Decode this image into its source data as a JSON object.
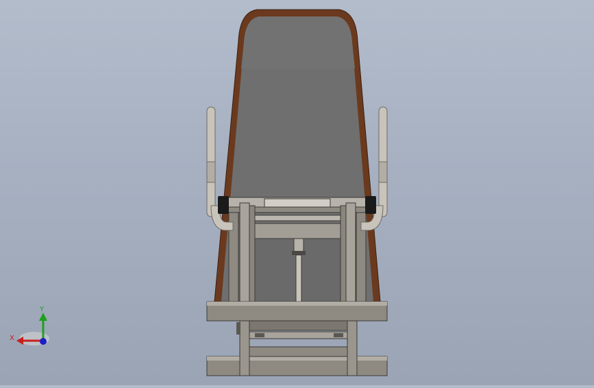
{
  "model": {
    "colors": {
      "background_top": "#b3bccb",
      "background_bottom": "#9aa4b4",
      "seat_panel": "#6d6d6d",
      "seat_frame": "#6b3a1e",
      "metal": "#a8a39b",
      "metal_dark": "#6e6a63",
      "pad_black": "#1a1a1a"
    }
  },
  "triad": {
    "x_label": "X",
    "y_label": "Y",
    "x_color": "#c81e1e",
    "y_color": "#1ea01e",
    "z_color": "#1e1ec8"
  }
}
